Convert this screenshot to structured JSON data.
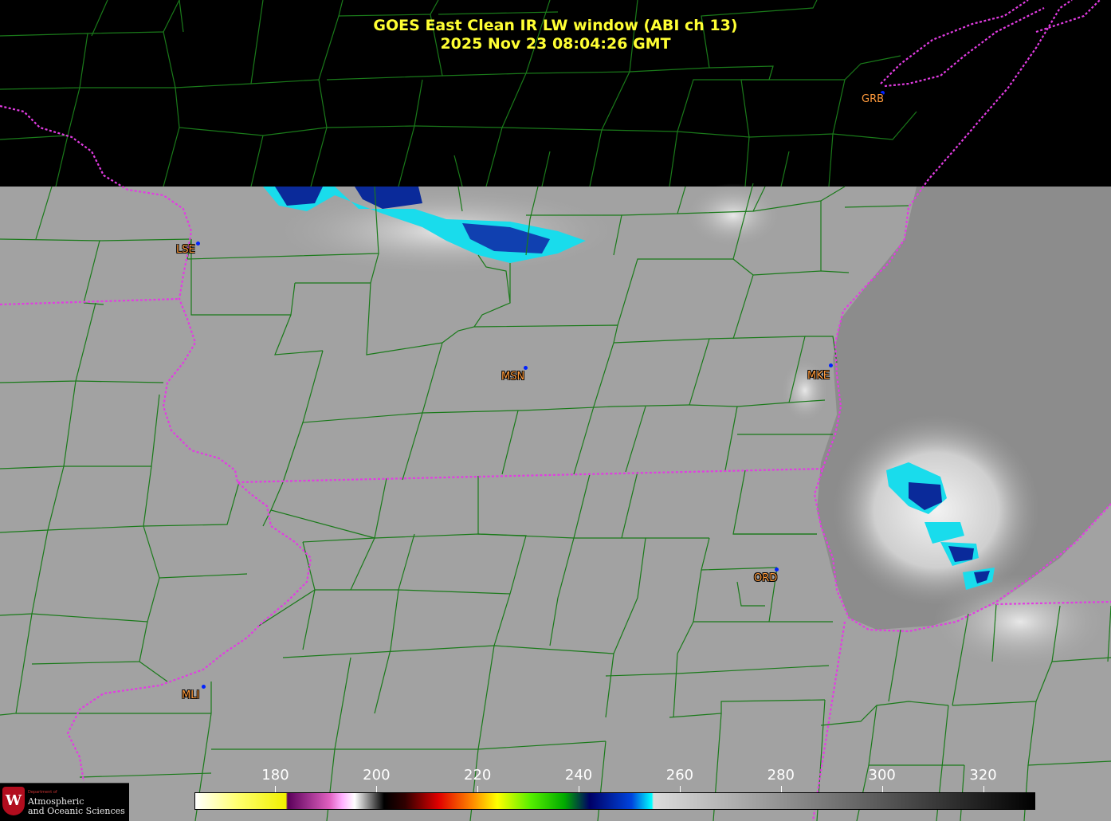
{
  "title": {
    "line1": "GOES East Clean IR LW window (ABI ch 13)",
    "line2": "2025 Nov 23  08:04:26 GMT"
  },
  "stations": [
    {
      "code": "GRB"
    },
    {
      "code": "LSE"
    },
    {
      "code": "MSN"
    },
    {
      "code": "MKE"
    },
    {
      "code": "ORD"
    },
    {
      "code": "MLI"
    }
  ],
  "colorbar": {
    "ticks": [
      "180",
      "200",
      "220",
      "240",
      "260",
      "280",
      "300",
      "320"
    ],
    "tick_values": [
      180,
      200,
      220,
      240,
      260,
      280,
      300,
      320
    ],
    "range": [
      164,
      330
    ]
  },
  "colors": {
    "title": "#ffff33",
    "county_lines": "#1a7a1a",
    "state_lines": "#e23ce2",
    "station_label": "#ff9a3c",
    "station_dot": "#0022ff"
  },
  "logo": {
    "seal": "W",
    "dept": "Department of",
    "name_line1": "Atmospheric",
    "name_line2": "and Oceanic Sciences"
  }
}
